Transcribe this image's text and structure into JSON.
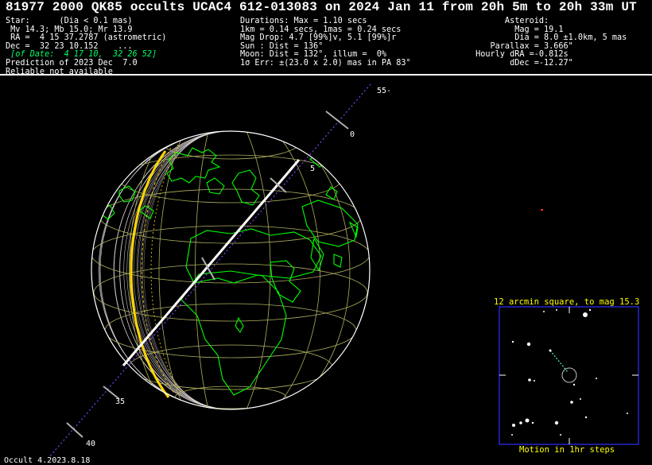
{
  "header": {
    "title": "81977 2000 QK85 occults UCAC4 612-013083 on 2024 Jan 11 from 20h  5m to 20h 33m UT"
  },
  "star": {
    "lines": [
      "Star:      (Dia < 0.1 mas)",
      " Mv 14.3; Mb 15.0; Mr 13.9",
      " RA =  4 15 37.2787 (astrometric)",
      "Dec =  32 23 10.152    ..."
    ],
    "of_date": " [of Date:  4 17 10,  32 26 52]",
    "lines2": [
      "Prediction of 2023 Dec  7.0",
      "Reliable not available"
    ]
  },
  "event": {
    "lines": [
      "Durations: Max = 1.10 secs",
      "1km = 0.14 secs, 1mas = 0.24 secs",
      "Mag Drop: 4.7 [99%]v, 5.1 [99%]r",
      "Sun : Dist = 136°",
      "Moon: Dist = 132°, illum =  0%",
      "1σ Err: ±(23.0 x 2.0) mas in PA 83°"
    ]
  },
  "asteroid": {
    "lines": [
      "       Asteroid:",
      "         Mag = 19.1",
      "         Dia = 8.0 ±1.0km, 5 mas",
      "    Parallax = 3.666\"",
      " Hourly dRA =-0.812s",
      "        dDec =-12.27\""
    ]
  },
  "path_labels": [
    "55-",
    "0",
    "5",
    "35",
    "40"
  ],
  "skymap": {
    "title": "12 arcmin square, to mag 15.3",
    "motion": "Motion in 1hr steps"
  },
  "footer": "Occult 4.2023.8.18",
  "colors": {
    "path": "#ffffff",
    "coast": "#00ff00",
    "grid": "#b0b060",
    "limb": "#ffd700",
    "track": "#8040ff",
    "sky_frame": "#3030ff",
    "sky_text": "#ffff00"
  }
}
